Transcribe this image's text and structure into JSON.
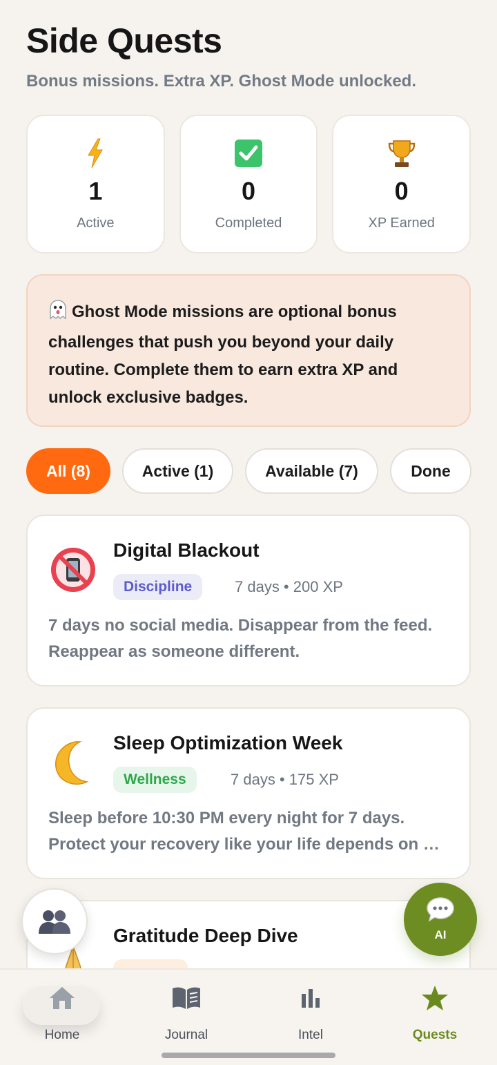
{
  "page": {
    "title": "Side Quests",
    "subtitle": "Bonus missions. Extra XP. Ghost Mode unlocked."
  },
  "stats": [
    {
      "icon": "lightning-icon",
      "value": "1",
      "label": "Active"
    },
    {
      "icon": "checkmark-icon",
      "value": "0",
      "label": "Completed"
    },
    {
      "icon": "trophy-icon",
      "value": "0",
      "label": "XP Earned"
    }
  ],
  "notice": {
    "icon": "ghost-icon",
    "text": "Ghost Mode missions are optional bonus challenges that push you beyond your daily routine. Complete them to earn extra XP and unlock exclusive badges."
  },
  "filters": [
    {
      "label": "All (8)",
      "selected": true
    },
    {
      "label": "Active (1)",
      "selected": false
    },
    {
      "label": "Available (7)",
      "selected": false
    },
    {
      "label": "Done",
      "selected": false
    }
  ],
  "quests": [
    {
      "icon": "no-phone-icon",
      "title": "Digital Blackout",
      "tag": "Discipline",
      "meta": "7 days • 200 XP",
      "description": "7 days no social media. Disappear from the feed. Reappear as someone different."
    },
    {
      "icon": "crescent-moon-icon",
      "title": "Sleep Optimization Week",
      "tag": "Wellness",
      "meta": "7 days • 175 XP",
      "description": "Sleep before 10:30 PM every night for 7 days. Protect your recovery like your life depends on …"
    },
    {
      "icon": "praying-hands-icon",
      "title": "Gratitude Deep Dive"
    }
  ],
  "fab": {
    "ai_label": "AI"
  },
  "nav": [
    {
      "icon": "home-icon",
      "label": "Home"
    },
    {
      "icon": "book-icon",
      "label": "Journal"
    },
    {
      "icon": "bar-chart-icon",
      "label": "Intel"
    },
    {
      "icon": "star-icon",
      "label": "Quests"
    }
  ],
  "colors": {
    "accent_orange": "#ff6a10",
    "accent_green": "#6d8c22",
    "background": "#f6f3ef"
  }
}
